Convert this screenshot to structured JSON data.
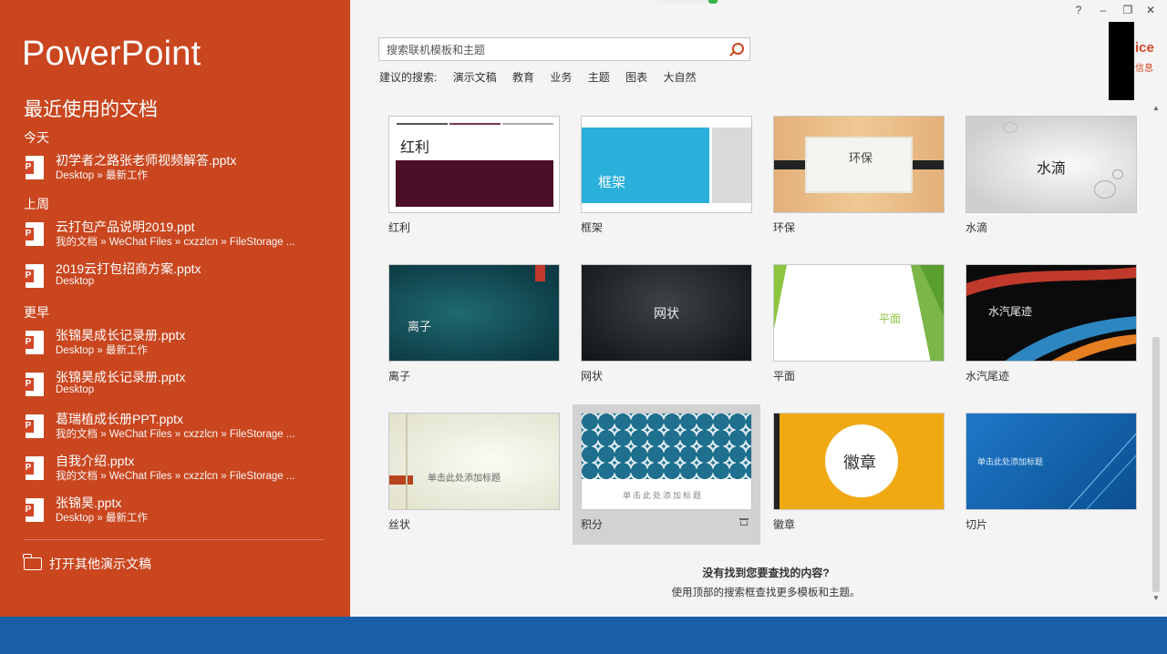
{
  "app": {
    "name": "PowerPoint",
    "recent_title": "最近使用的文档",
    "accent_color": "#c9461f"
  },
  "recent_groups": [
    {
      "label": "今天"
    },
    {
      "label": "上周"
    },
    {
      "label": "更早"
    }
  ],
  "recent_docs": [
    {
      "name": "初学者之路张老师视频解答.pptx",
      "path": "Desktop » 最新工作"
    },
    {
      "name": "云打包产品说明2019.ppt",
      "path": "我的文档 » WeChat Files » cxzzlcn » FileStorage ..."
    },
    {
      "name": "2019云打包招商方案.pptx",
      "path": "Desktop"
    },
    {
      "name": "张锦昊成长记录册.pptx",
      "path": "Desktop » 最新工作"
    },
    {
      "name": "张锦昊成长记录册.pptx",
      "path": "Desktop"
    },
    {
      "name": "葛瑞植成长册PPT.pptx",
      "path": "我的文档 » WeChat Files » cxzzlcn » FileStorage ..."
    },
    {
      "name": "自我介绍.pptx",
      "path": "我的文档 » WeChat Files » cxzzlcn » FileStorage ..."
    },
    {
      "name": "张锦昊.pptx",
      "path": "Desktop » 最新工作"
    }
  ],
  "open_other": "打开其他演示文稿",
  "window_controls": {
    "help": "?",
    "minimize": "–",
    "restore": "❐",
    "close": "✕"
  },
  "account": {
    "text": "ice",
    "sub": "信息"
  },
  "search": {
    "placeholder": "搜索联机模板和主题"
  },
  "suggestions": {
    "label": "建议的搜索:",
    "items": [
      "演示文稿",
      "教育",
      "业务",
      "主题",
      "图表",
      "大自然"
    ]
  },
  "templates": [
    {
      "label": "红利",
      "thumb_text": "红利"
    },
    {
      "label": "框架",
      "thumb_text": "框架"
    },
    {
      "label": "环保",
      "thumb_text": "环保"
    },
    {
      "label": "水滴",
      "thumb_text": "水滴"
    },
    {
      "label": "离子",
      "thumb_text": "离子"
    },
    {
      "label": "网状",
      "thumb_text": "网状"
    },
    {
      "label": "平面",
      "thumb_text": "平面"
    },
    {
      "label": "水汽尾迹",
      "thumb_text": "水汽尾迹"
    },
    {
      "label": "丝状",
      "thumb_text": "单击此处添加标题"
    },
    {
      "label": "积分",
      "thumb_text": "单击此处添加标题"
    },
    {
      "label": "徽章",
      "thumb_text": "徽章"
    },
    {
      "label": "切片",
      "thumb_text": "单击此处添加标题"
    }
  ],
  "not_found": {
    "title": "没有找到您要查找的内容?",
    "subtitle": "使用顶部的搜索框查找更多模板和主题。"
  }
}
